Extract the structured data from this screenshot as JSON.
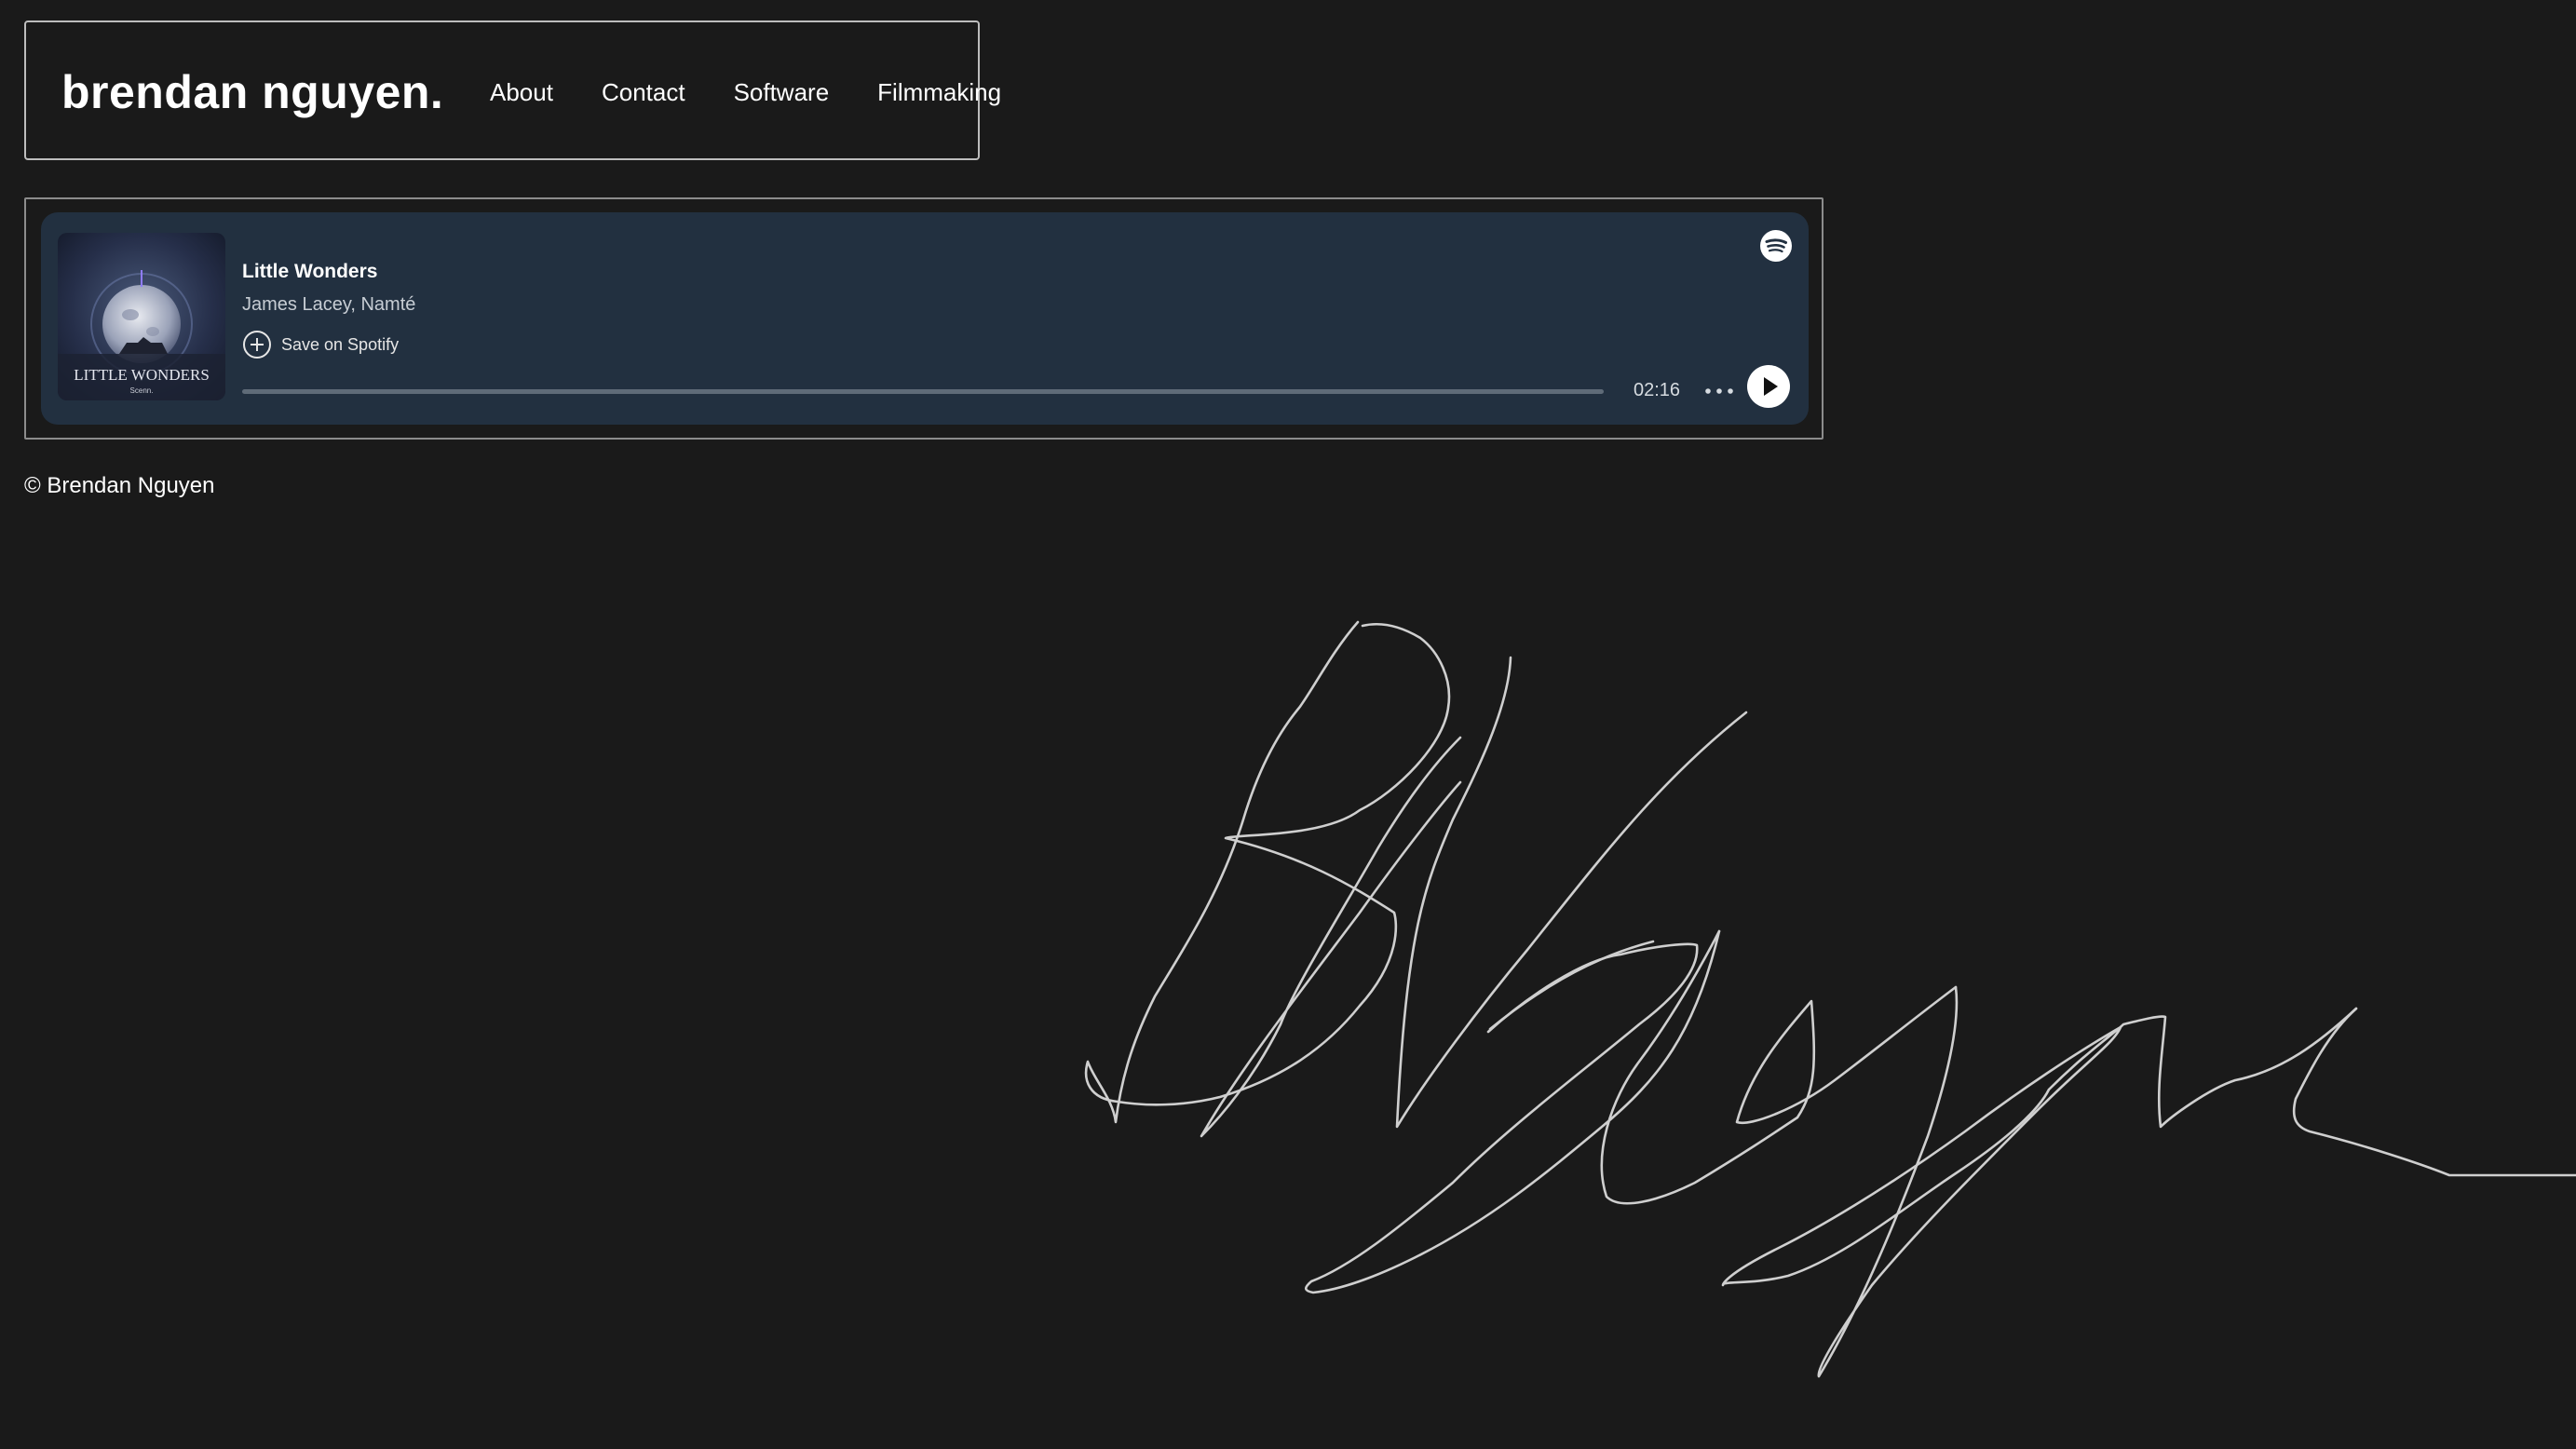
{
  "header": {
    "brand": "brendan nguyen.",
    "nav": [
      {
        "label": "About"
      },
      {
        "label": "Contact"
      },
      {
        "label": "Software"
      },
      {
        "label": "Filmmaking"
      }
    ]
  },
  "player": {
    "album_art": {
      "title_text": "LITTLE WONDERS",
      "label_text": "Scenn."
    },
    "track_title": "Little Wonders",
    "artists": "James Lacey, Namté",
    "save_label": "Save on Spotify",
    "duration": "02:16",
    "progress_fraction": 0.0,
    "icons": {
      "save": "plus-circle-icon",
      "more": "more-options-icon",
      "play": "play-icon",
      "brand": "spotify-logo-icon"
    },
    "colors": {
      "background": "#223040",
      "accent": "#ffffff"
    }
  },
  "footer": {
    "copyright": "© Brendan Nguyen"
  },
  "colors": {
    "page_background": "#1a1a1a",
    "text": "#ffffff"
  }
}
